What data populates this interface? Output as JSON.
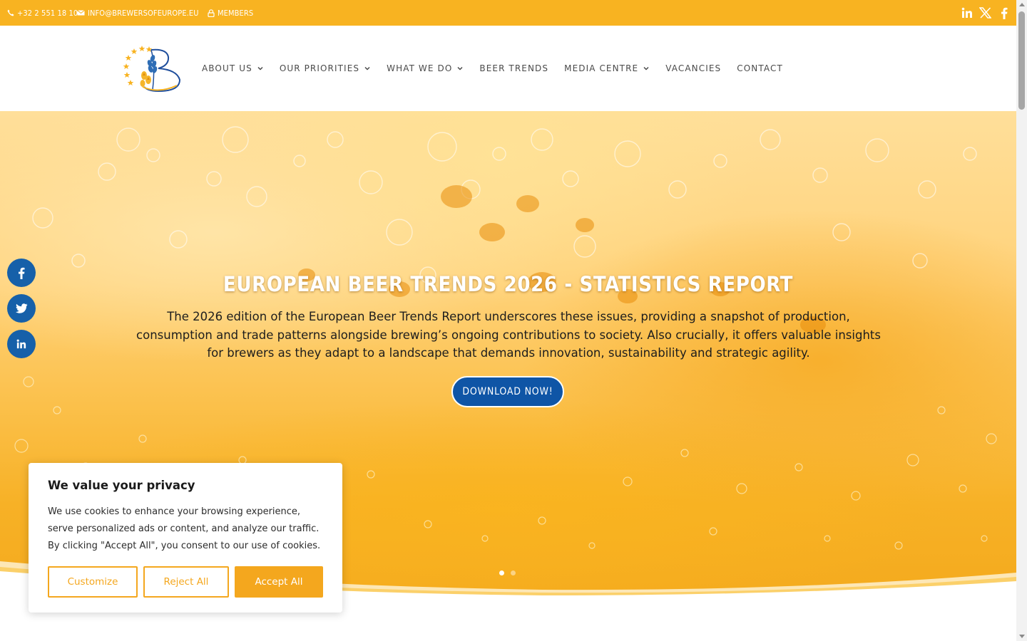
{
  "topbar": {
    "phone": "+32 2 551 18 10",
    "email": "INFO@BREWERSOFEUROPE.EU",
    "members": "MEMBERS",
    "social_icons": [
      "linkedin-icon",
      "x-twitter-icon",
      "facebook-icon"
    ]
  },
  "nav": {
    "items": [
      {
        "label": "ABOUT US",
        "has_dropdown": true
      },
      {
        "label": "OUR PRIORITIES",
        "has_dropdown": true
      },
      {
        "label": "WHAT WE DO",
        "has_dropdown": true
      },
      {
        "label": "BEER TRENDS",
        "has_dropdown": false
      },
      {
        "label": "MEDIA CENTRE",
        "has_dropdown": true
      },
      {
        "label": "VACANCIES",
        "has_dropdown": false
      },
      {
        "label": "CONTACT",
        "has_dropdown": false
      }
    ]
  },
  "hero": {
    "title": "EUROPEAN BEER TRENDS 2026 - STATISTICS REPORT",
    "text": "The 2026 edition of the European Beer Trends Report underscores these issues, providing a snapshot of production, consumption and trade patterns alongside brewing’s ongoing contributions to society. Also crucially, it offers valuable insights for brewers as they adapt to a landscape that demands innovation, sustainability and strategic agility.",
    "button": "DOWNLOAD NOW!",
    "slides": 2,
    "active_slide": 1
  },
  "share": [
    "facebook-icon",
    "twitter-icon",
    "linkedin-icon"
  ],
  "cookie": {
    "title": "We value your privacy",
    "text": "We use cookies to enhance your browsing experience, serve personalized ads or content, and analyze our traffic. By clicking \"Accept All\", you consent to our use of cookies.",
    "customize": "Customize",
    "reject": "Reject All",
    "accept": "Accept All"
  },
  "colors": {
    "brand_yellow": "#f8b321",
    "brand_blue": "#0f55a6",
    "cookie_orange": "#f4a71e"
  }
}
